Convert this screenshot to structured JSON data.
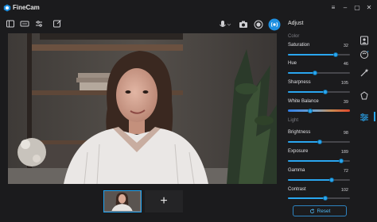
{
  "window": {
    "title": "FineCam"
  },
  "toolbar": {
    "icons": [
      "layout-icon",
      "aspect-icon",
      "adjust-icon",
      "edit-icon"
    ],
    "mic_icon": "microphone-icon",
    "camera_icon": "camera-icon",
    "record_icon": "record-icon",
    "live_icon": "live-stream-icon"
  },
  "panel": {
    "title": "Adjust",
    "sections": [
      {
        "label": "Color",
        "rows": [
          {
            "label": "Saturation",
            "value": "32",
            "level": 0.77
          },
          {
            "label": "Hue",
            "value": "46",
            "level": 0.44
          },
          {
            "label": "Sharpness",
            "value": "105",
            "level": 0.6
          },
          {
            "label": "White Balance",
            "value": "39",
            "level": 0.36
          }
        ]
      },
      {
        "label": "Light",
        "rows": [
          {
            "label": "Brightness",
            "value": "98",
            "level": 0.51
          },
          {
            "label": "Exposure",
            "value": "189",
            "level": 0.86
          },
          {
            "label": "Gamma",
            "value": "72",
            "level": 0.7
          },
          {
            "label": "Contrast",
            "value": "102",
            "level": 0.6
          }
        ]
      }
    ],
    "reset_label": "Reset"
  },
  "strip": {
    "add_label": "+"
  },
  "colors": {
    "accent": "#2aa6ef",
    "background": "#1b1b1d"
  }
}
